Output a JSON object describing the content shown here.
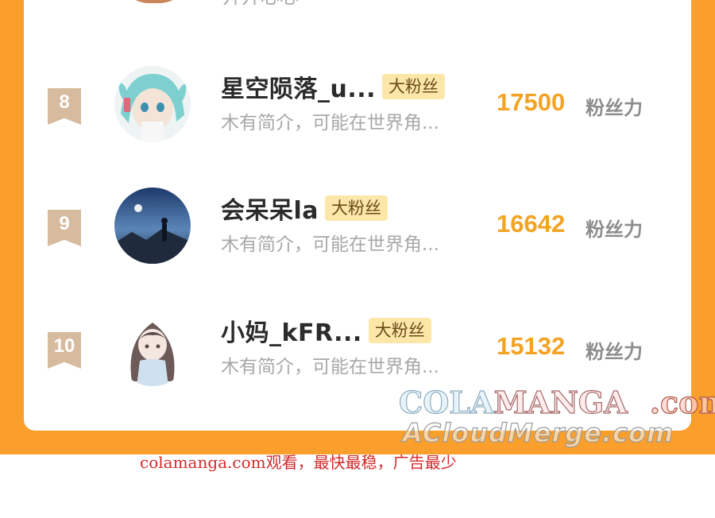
{
  "previous_row": {
    "description_fragment": "开开心心"
  },
  "entries": [
    {
      "rank": "8",
      "name": "星空陨落_u...",
      "badge": "大粉丝",
      "description": "木有简介，可能在世界角...",
      "score": "17500",
      "score_unit": "粉丝力"
    },
    {
      "rank": "9",
      "name": "会呆呆la",
      "badge": "大粉丝",
      "description": "木有简介，可能在世界角...",
      "score": "16642",
      "score_unit": "粉丝力"
    },
    {
      "rank": "10",
      "name": "小妈_kFR...",
      "badge": "大粉丝",
      "description": "木有简介，可能在世界角...",
      "score": "15132",
      "score_unit": "粉丝力"
    }
  ],
  "watermark": {
    "line1_part1": "COLA",
    "line1_part2": "MANGA",
    "line1_part3": ".com",
    "line2": "ACloudMerge.com"
  },
  "footer_note": "colamanga.com观看，最快最稳，广告最少",
  "colors": {
    "frame": "#fa9f2c",
    "score": "#f3a324",
    "badge_bg": "#fde7a8",
    "rank_ribbon": "#d6bb9f",
    "footer_text": "#d22a2a"
  },
  "icons": [
    "rank-ribbon-icon"
  ]
}
